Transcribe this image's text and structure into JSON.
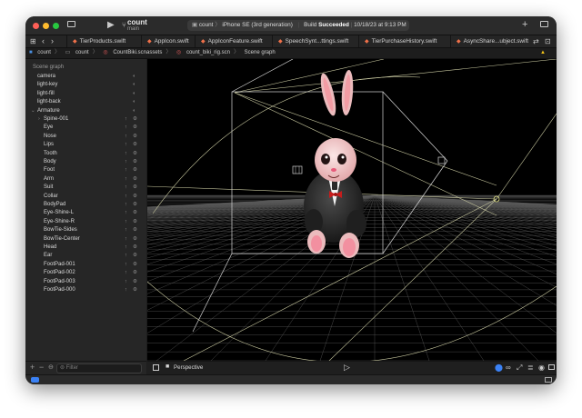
{
  "scheme": {
    "name": "count",
    "branch": "main"
  },
  "toolbar": {
    "target": "count",
    "device": "iPhone SE (3rd generation)",
    "build_prefix": "Build",
    "build_result": "Succeeded",
    "build_time": "10/18/23 at 9:13 PM",
    "warning_count": "1"
  },
  "tabs": [
    "TierProducts.swift",
    "AppIcon.swift",
    "AppIconFeature.swift",
    "SpeechSynt...ttings.swift",
    "TierPurchaseHistory.swift",
    "AsyncShare...ubject.swift"
  ],
  "breadcrumb": [
    "count",
    "count",
    "CountBiki.scnassets",
    "count_biki_rig.scn",
    "Scene graph"
  ],
  "sidebar": {
    "header": "Scene graph",
    "nodes": [
      {
        "label": "camera",
        "depth": 0
      },
      {
        "label": "light-key",
        "depth": 0
      },
      {
        "label": "light-fill",
        "depth": 0
      },
      {
        "label": "light-back",
        "depth": 0
      },
      {
        "label": "Armature",
        "depth": 0,
        "disclosure": "open"
      },
      {
        "label": "Spine-001",
        "depth": 1,
        "disclosure": "closed"
      },
      {
        "label": "Eye",
        "depth": 1
      },
      {
        "label": "Nose",
        "depth": 1
      },
      {
        "label": "Lips",
        "depth": 1
      },
      {
        "label": "Tooth",
        "depth": 1
      },
      {
        "label": "Body",
        "depth": 1
      },
      {
        "label": "Foot",
        "depth": 1
      },
      {
        "label": "Arm",
        "depth": 1
      },
      {
        "label": "Suit",
        "depth": 1
      },
      {
        "label": "Collar",
        "depth": 1
      },
      {
        "label": "BodyPad",
        "depth": 1
      },
      {
        "label": "Eye-Shine-L",
        "depth": 1
      },
      {
        "label": "Eye-Shine-R",
        "depth": 1
      },
      {
        "label": "BowTie-Sides",
        "depth": 1
      },
      {
        "label": "BowTie-Center",
        "depth": 1
      },
      {
        "label": "Head",
        "depth": 1
      },
      {
        "label": "Ear",
        "depth": 1
      },
      {
        "label": "FootPad-001",
        "depth": 1
      },
      {
        "label": "FootPad-002",
        "depth": 1
      },
      {
        "label": "FootPad-003",
        "depth": 1
      },
      {
        "label": "FootPad-000",
        "depth": 1
      }
    ],
    "filter_placeholder": "Filter"
  },
  "viewport": {
    "camera_mode": "Perspective"
  },
  "colors": {
    "accent": "#3b82f6",
    "warning": "#f5c518",
    "swift": "#f0714a",
    "build_success": "#ffffff"
  }
}
